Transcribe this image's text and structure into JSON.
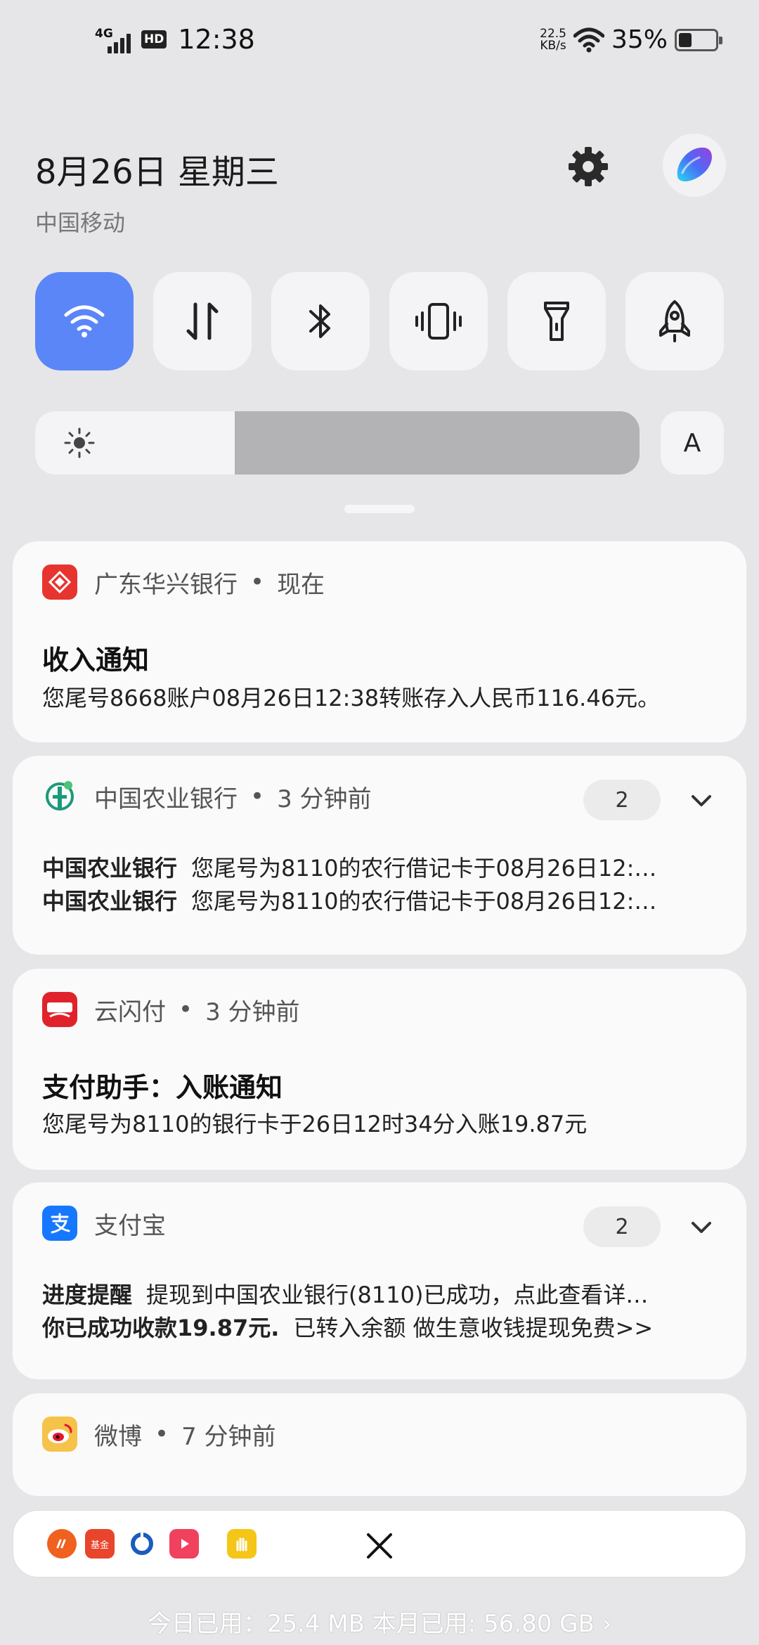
{
  "status_bar": {
    "network": "4G",
    "hd": "HD",
    "time": "12:38",
    "speed_value": "22.5",
    "speed_unit": "KB/s",
    "battery_pct": "35%",
    "battery_level": 0.35
  },
  "header": {
    "date": "8月26日 星期三",
    "carrier": "中国移动"
  },
  "quick_toggles": [
    {
      "name": "wifi-icon",
      "active": true
    },
    {
      "name": "mobile-data-icon",
      "active": false
    },
    {
      "name": "bluetooth-icon",
      "active": false
    },
    {
      "name": "vibrate-icon",
      "active": false
    },
    {
      "name": "flashlight-icon",
      "active": false
    },
    {
      "name": "rocket-icon",
      "active": false
    }
  ],
  "brightness": {
    "level": 0.33,
    "auto_label": "A"
  },
  "notifications": [
    {
      "app": "广东华兴银行",
      "time": "现在",
      "title": "收入通知",
      "body": "您尾号8668账户08月26日12:38转账存入人民币116.46元。",
      "color": "#e8342e"
    },
    {
      "app": "中国农业银行",
      "time": "3 分钟前",
      "count": "2",
      "lines": [
        {
          "sender": "中国农业银行",
          "text": "您尾号为8110的农行借记卡于08月26日12:…"
        },
        {
          "sender": "中国农业银行",
          "text": "您尾号为8110的农行借记卡于08月26日12:…"
        }
      ],
      "color": "#1a9a7a"
    },
    {
      "app": "云闪付",
      "time": "3 分钟前",
      "title": "支付助手：入账通知",
      "body": "您尾号为8110的银行卡于26日12时34分入账19.87元",
      "color": "#e0232a"
    },
    {
      "app": "支付宝",
      "time": "",
      "count": "2",
      "lines": [
        {
          "sender": "进度提醒",
          "text": "提现到中国农业银行(8110)已成功，点此查看详…"
        },
        {
          "sender": "你已成功收款19.87元.",
          "text": "已转入余额 做生意收钱提现免费>>"
        }
      ],
      "color": "#1677ff"
    },
    {
      "app": "微博",
      "time": "7 分钟前",
      "color": "#f5a623"
    }
  ],
  "dock": {
    "icons": [
      "mi-icon",
      "jiyin-icon",
      "ccb-icon",
      "video-icon",
      "hand-icon"
    ],
    "jiyin_label": "基金"
  },
  "usage": "今日已用：25.4 MB 本月已用: 56.80 GB ›"
}
